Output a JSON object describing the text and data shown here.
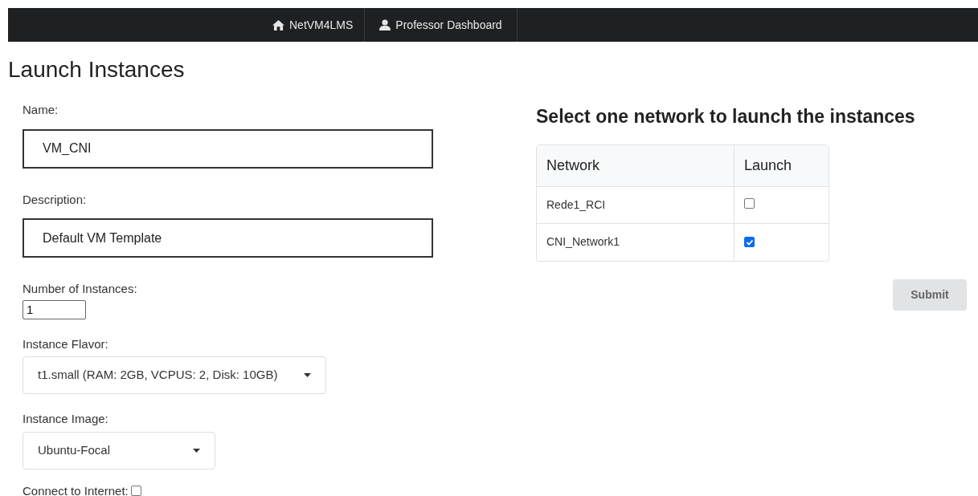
{
  "navbar": {
    "items": [
      {
        "label": "NetVM4LMS",
        "kind": "home"
      },
      {
        "label": "Professor Dashboard",
        "kind": "user"
      }
    ]
  },
  "page_title": "Launch Instances",
  "form": {
    "name": {
      "label": "Name:",
      "value": "VM_CNI"
    },
    "description": {
      "label": "Description:",
      "value": "Default VM Template"
    },
    "instances": {
      "label": "Number of Instances:",
      "value": "1"
    },
    "flavor": {
      "label": "Instance Flavor:",
      "value": "t1.small (RAM: 2GB, VCPUS: 2, Disk: 10GB)"
    },
    "image": {
      "label": "Instance Image:",
      "value": "Ubuntu-Focal"
    },
    "internet": {
      "label": "Connect to Internet:",
      "checked": false
    }
  },
  "network_panel": {
    "title": "Select one network to launch the instances",
    "table": {
      "columns": [
        "Network",
        "Launch"
      ],
      "rows": [
        {
          "network": "Rede1_RCI",
          "checked": false
        },
        {
          "network": "CNI_Network1",
          "checked": true
        }
      ]
    },
    "submit": {
      "label": "Submit",
      "disabled": true
    }
  }
}
